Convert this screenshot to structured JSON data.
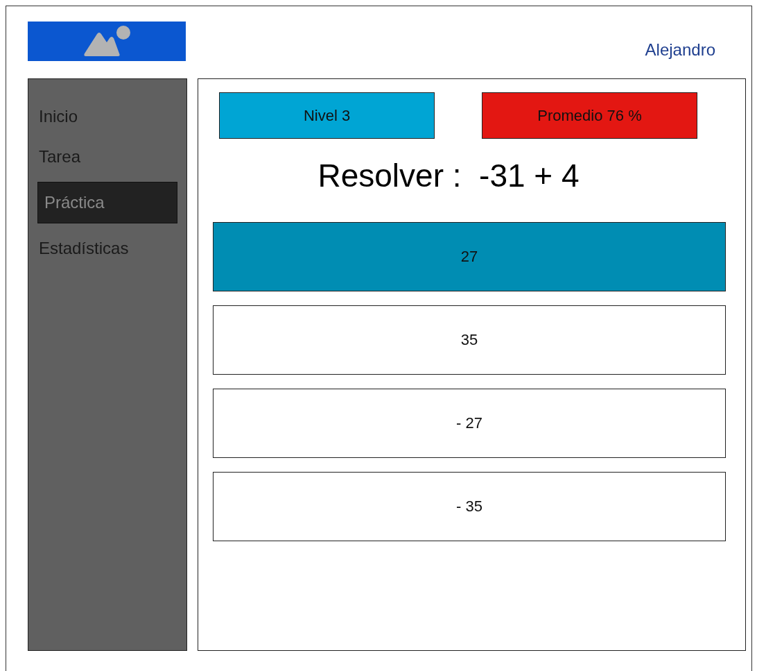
{
  "header": {
    "user": "Alejandro"
  },
  "sidebar": {
    "items": [
      {
        "label": "Inicio",
        "selected": false
      },
      {
        "label": "Tarea",
        "selected": false
      },
      {
        "label": "Práctica",
        "selected": true
      },
      {
        "label": "Estadísticas",
        "selected": false
      }
    ]
  },
  "badges": [
    {
      "label": "Nivel 3",
      "color": "#00a5d4"
    },
    {
      "label": "Promedio 76 %",
      "color": "#e31712"
    }
  ],
  "problem": "Resolver :  -31 + 4",
  "answers": [
    {
      "label": "27",
      "selected": true
    },
    {
      "label": "35",
      "selected": false
    },
    {
      "label": "- 27",
      "selected": false
    },
    {
      "label": "- 35",
      "selected": false
    }
  ]
}
